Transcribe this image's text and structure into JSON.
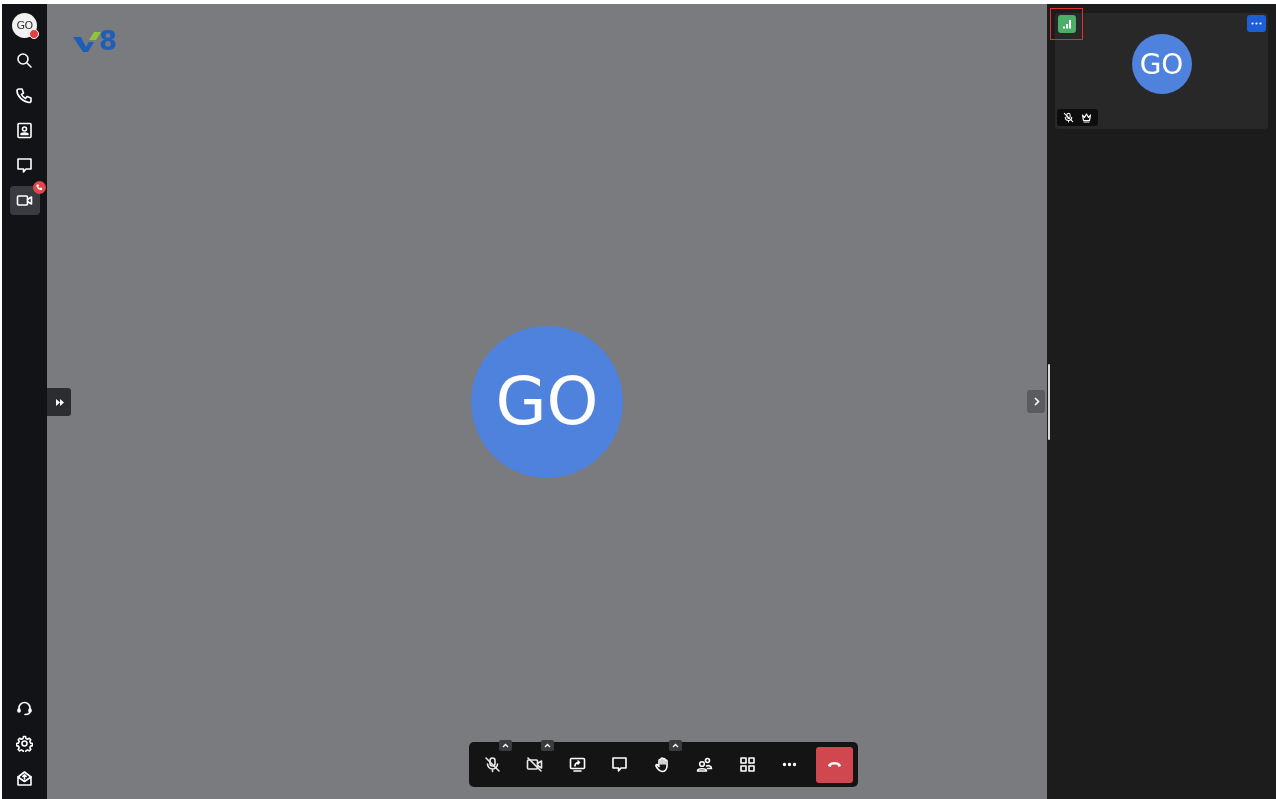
{
  "sidebar": {
    "avatar": {
      "initials": "GO",
      "status_badge": true
    },
    "items": [
      {
        "kind": "search",
        "selected": false,
        "badge": false
      },
      {
        "kind": "phone",
        "selected": false,
        "badge": false
      },
      {
        "kind": "contacts",
        "selected": false,
        "badge": false
      },
      {
        "kind": "chat",
        "selected": false,
        "badge": false
      },
      {
        "kind": "video",
        "selected": true,
        "badge": true
      }
    ],
    "bottom_items": [
      {
        "kind": "headset"
      },
      {
        "kind": "settings"
      },
      {
        "kind": "mail"
      }
    ]
  },
  "logo": {
    "text": "8"
  },
  "stage": {
    "initials": "GO"
  },
  "participants": [
    {
      "initials": "GO",
      "muted": true,
      "host": true,
      "signal_highlighted": true
    }
  ],
  "toolbar": [
    {
      "kind": "mic",
      "off": true,
      "menu": true
    },
    {
      "kind": "camera",
      "off": true,
      "menu": true
    },
    {
      "kind": "share",
      "off": false,
      "menu": false
    },
    {
      "kind": "chat",
      "off": false,
      "menu": false
    },
    {
      "kind": "hand",
      "off": false,
      "menu": true
    },
    {
      "kind": "people",
      "off": false,
      "menu": false
    },
    {
      "kind": "grid",
      "off": false,
      "menu": false
    },
    {
      "kind": "more",
      "off": false,
      "menu": false
    },
    {
      "kind": "hangup",
      "off": false,
      "menu": false
    }
  ]
}
